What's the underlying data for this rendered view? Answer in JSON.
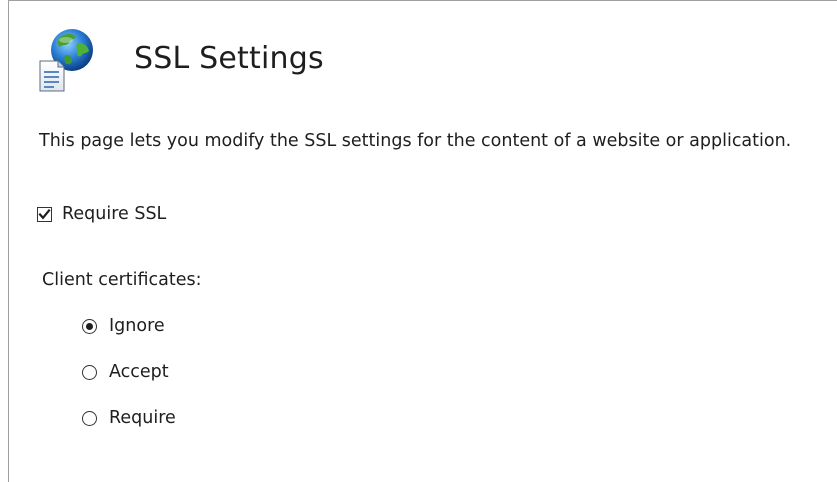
{
  "header": {
    "title": "SSL Settings",
    "icon": "globe-document-icon"
  },
  "description": "This page lets you modify the SSL settings for the content of a website or application.",
  "require_ssl": {
    "label": "Require SSL",
    "checked": true
  },
  "client_certificates": {
    "label": "Client certificates:",
    "options": [
      {
        "label": "Ignore",
        "selected": true
      },
      {
        "label": "Accept",
        "selected": false
      },
      {
        "label": "Require",
        "selected": false
      }
    ]
  },
  "colors": {
    "text": "#1e1e1e",
    "border": "#a0a0a0",
    "globe_blue": "#1f6fc1",
    "globe_green": "#3f9a2f"
  }
}
